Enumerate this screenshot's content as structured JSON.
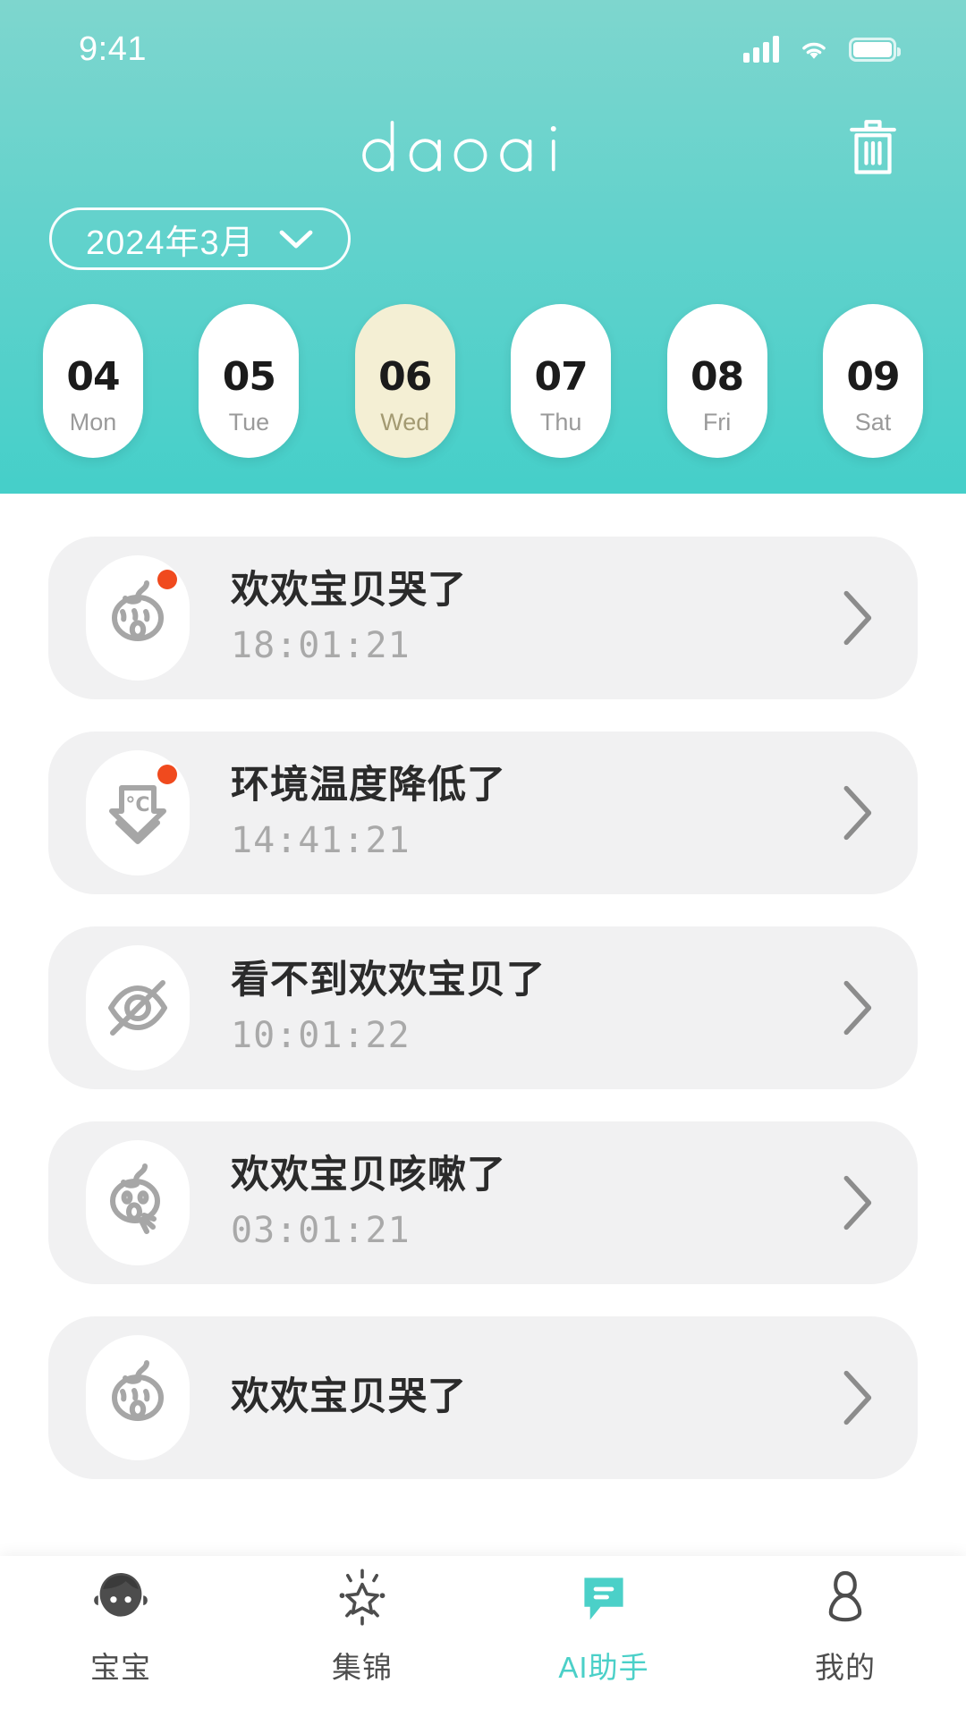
{
  "theme": {
    "teal_top": "#7ED6CE",
    "teal_bottom": "#45CFC9",
    "accent": "#4BD0C8",
    "selected_day_bg": "#F4EFD4",
    "card_bg": "#F1F1F2",
    "badge_red": "#F04A1E"
  },
  "status_bar": {
    "time": "9:41",
    "signal_icon": "cellular-signal-icon",
    "wifi_icon": "wifi-icon",
    "battery_icon": "battery-icon"
  },
  "header": {
    "brand": "daoai",
    "delete_icon": "trash-icon",
    "month_label": "2024年3月",
    "month_chevron_icon": "chevron-down-icon"
  },
  "calendar": {
    "days": [
      {
        "num": "04",
        "weekday": "Mon",
        "selected": false
      },
      {
        "num": "05",
        "weekday": "Tue",
        "selected": false
      },
      {
        "num": "06",
        "weekday": "Wed",
        "selected": true
      },
      {
        "num": "07",
        "weekday": "Thu",
        "selected": false
      },
      {
        "num": "08",
        "weekday": "Fri",
        "selected": false
      },
      {
        "num": "09",
        "weekday": "Sat",
        "selected": false
      }
    ]
  },
  "events": [
    {
      "title": "欢欢宝贝哭了",
      "time": "18:01:21",
      "icon": "crying-baby-icon",
      "unread": true,
      "chevron": "chevron-right-icon"
    },
    {
      "title": "环境温度降低了",
      "time": "14:41:21",
      "icon": "temperature-down-icon",
      "unread": true,
      "chevron": "chevron-right-icon"
    },
    {
      "title": "看不到欢欢宝贝了",
      "time": "10:01:22",
      "icon": "eye-off-icon",
      "unread": false,
      "chevron": "chevron-right-icon"
    },
    {
      "title": "欢欢宝贝咳嗽了",
      "time": "03:01:21",
      "icon": "coughing-baby-icon",
      "unread": false,
      "chevron": "chevron-right-icon"
    },
    {
      "title": "欢欢宝贝哭了",
      "time": "",
      "icon": "crying-baby-icon",
      "unread": false,
      "chevron": "chevron-right-icon"
    }
  ],
  "tabbar": [
    {
      "label": "宝宝",
      "icon": "baby-face-icon",
      "active": false
    },
    {
      "label": "集锦",
      "icon": "sparkle-star-icon",
      "active": false
    },
    {
      "label": "AI助手",
      "icon": "chat-bubble-icon",
      "active": true
    },
    {
      "label": "我的",
      "icon": "person-icon",
      "active": false
    }
  ]
}
